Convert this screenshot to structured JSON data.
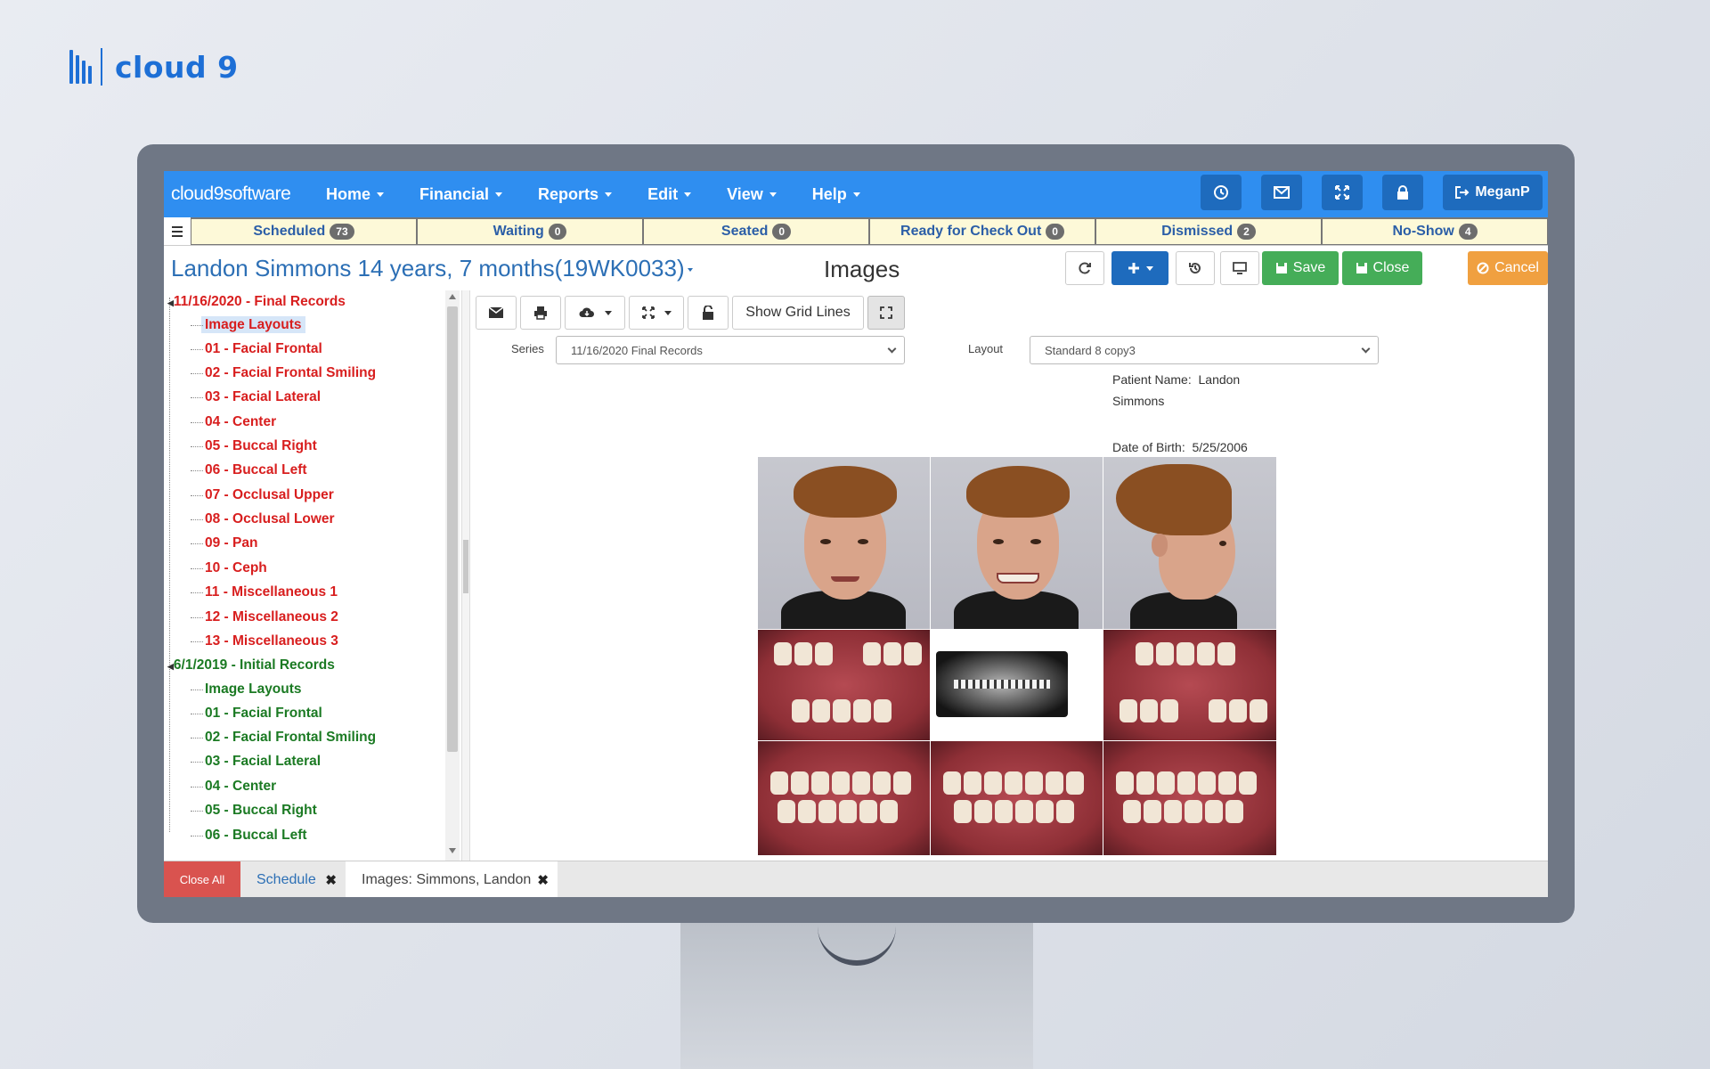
{
  "brand": {
    "text": "cloud 9"
  },
  "nav": {
    "brand": "cloud9software",
    "menus": [
      "Home",
      "Financial",
      "Reports",
      "Edit",
      "View",
      "Help"
    ],
    "user": "MeganP",
    "accent": "#2f8ef0"
  },
  "status_bar": [
    {
      "label": "Scheduled",
      "count": "73"
    },
    {
      "label": "Waiting",
      "count": "0"
    },
    {
      "label": "Seated",
      "count": "0"
    },
    {
      "label": "Ready for Check Out",
      "count": "0"
    },
    {
      "label": "Dismissed",
      "count": "2"
    },
    {
      "label": "No-Show",
      "count": "4"
    }
  ],
  "header": {
    "patient_title": "Landon Simmons 14 years, 7 months(19WK0033)",
    "page_heading": "Images",
    "save_label": "Save",
    "close_label": "Close",
    "cancel_label": "Cancel"
  },
  "tree": {
    "groups": [
      {
        "label": "11/16/2020 - Final Records",
        "color": "#d81e1e",
        "items": [
          "Image Layouts",
          "01 - Facial Frontal",
          "02 - Facial Frontal Smiling",
          "03 - Facial Lateral",
          "04 - Center",
          "05 - Buccal Right",
          "06 - Buccal Left",
          "07 - Occlusal Upper",
          "08 - Occlusal Lower",
          "09 - Pan",
          "10 - Ceph",
          "11 - Miscellaneous 1",
          "12 - Miscellaneous 2",
          "13 - Miscellaneous 3"
        ]
      },
      {
        "label": "6/1/2019 - Initial Records",
        "color": "#1b7a23",
        "items": [
          "Image Layouts",
          "01 - Facial Frontal",
          "02 - Facial Frontal Smiling",
          "03 - Facial Lateral",
          "04 - Center",
          "05 - Buccal Right",
          "06 - Buccal Left"
        ]
      }
    ],
    "selected": "Image Layouts"
  },
  "content": {
    "show_grid_lines_label": "Show Grid Lines",
    "series_label": "Series",
    "series_value": "11/16/2020 Final Records",
    "layout_label": "Layout",
    "layout_value": "Standard 8 copy3",
    "patient_name_label": "Patient Name:",
    "patient_first": "Landon",
    "patient_last": "Simmons",
    "dob_label": "Date of Birth:",
    "dob_value": "5/25/2006"
  },
  "bottom_tabs": {
    "close_all": "Close All",
    "schedule": "Schedule",
    "images": "Images: Simmons, Landon"
  }
}
